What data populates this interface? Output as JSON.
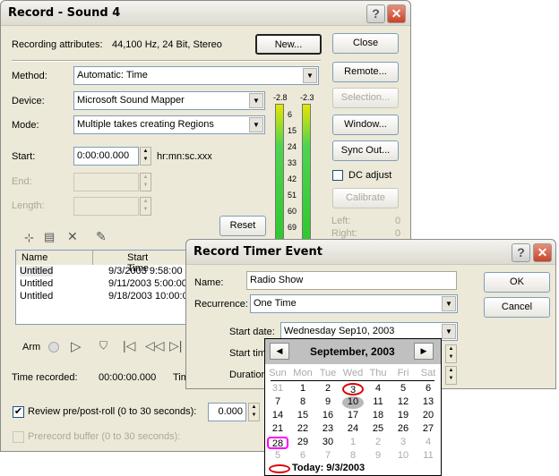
{
  "record": {
    "title": "Record - Sound 4",
    "attributes_label": "Recording attributes:",
    "attributes_value": "44,100 Hz, 24 Bit, Stereo",
    "new_btn": "New...",
    "close_btn": "Close",
    "remote_btn": "Remote...",
    "selection_btn": "Selection...",
    "window_btn": "Window...",
    "syncout_btn": "Sync Out...",
    "dc_adjust": "DC adjust",
    "calibrate_btn": "Calibrate",
    "left_label": "Left:",
    "left_value": "0",
    "right_label": "Right:",
    "right_value": "0",
    "method_label": "Method:",
    "method_value": "Automatic: Time",
    "device_label": "Device:",
    "device_value": "Microsoft Sound Mapper",
    "mode_label": "Mode:",
    "mode_value": "Multiple takes creating Regions",
    "start_label": "Start:",
    "start_value": "0:00:00.000",
    "time_format": "hr:mn:sc.xxx",
    "end_label": "End:",
    "length_label": "Length:",
    "reset_btn": "Reset",
    "meter": {
      "peak_left": "-2.8",
      "peak_right": "-2.3",
      "ticks": [
        "6",
        "15",
        "24",
        "33",
        "42",
        "51",
        "60",
        "69"
      ]
    },
    "list": {
      "columns": [
        "Name",
        "Start Time"
      ],
      "rows": [
        [
          "Untitled",
          "9/3/2003 9:58:00"
        ],
        [
          "Untitled",
          "9/11/2003 5:00:00"
        ],
        [
          "Untitled",
          "9/18/2003 10:00:00"
        ]
      ]
    },
    "arm_label": "Arm",
    "time_recorded_label": "Time recorded:",
    "time_recorded_value": "00:00:00.000",
    "time_label_partial": "Tim",
    "review_label": "Review pre/post-roll (0 to 30 seconds):",
    "review_checked": true,
    "review_value": "0.000",
    "prerecord_label": "Prerecord buffer (0 to 30 seconds):"
  },
  "timer": {
    "title": "Record Timer Event",
    "name_label": "Name:",
    "name_value": "Radio Show",
    "recurrence_label": "Recurrence:",
    "recurrence_value": "One Time",
    "start_date_label": "Start date:",
    "start_date_value": "Wednesday Sep10, 2003",
    "start_time_label": "Start tim",
    "duration_label": "Duration",
    "ok_btn": "OK",
    "cancel_btn": "Cancel"
  },
  "calendar": {
    "month": "September, 2003",
    "days": [
      "Sun",
      "Mon",
      "Tue",
      "Wed",
      "Thu",
      "Fri",
      "Sat"
    ],
    "weeks": [
      [
        "31",
        "1",
        "2",
        "3",
        "4",
        "5",
        "6"
      ],
      [
        "7",
        "8",
        "9",
        "10",
        "11",
        "12",
        "13"
      ],
      [
        "14",
        "15",
        "16",
        "17",
        "18",
        "19",
        "20"
      ],
      [
        "21",
        "22",
        "23",
        "24",
        "25",
        "26",
        "27"
      ],
      [
        "28",
        "29",
        "30",
        "1",
        "2",
        "3",
        "4"
      ],
      [
        "5",
        "6",
        "7",
        "8",
        "9",
        "10",
        "11"
      ]
    ],
    "selected": "10",
    "today_circled": "3",
    "highlighted": "28",
    "today_label": "Today: 9/3/2003"
  }
}
